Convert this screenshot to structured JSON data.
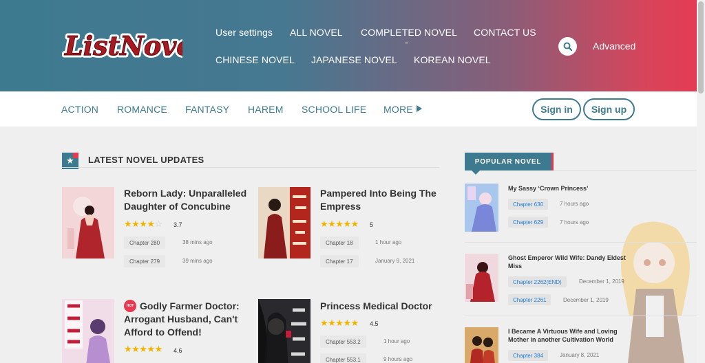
{
  "brand": {
    "logo_text": "ListNovel"
  },
  "nav": {
    "row1": [
      "User settings",
      "ALL NOVEL",
      "COMPLETED NOVEL",
      "CONTACT US"
    ],
    "row2": [
      "CHINESE NOVEL",
      "JAPANESE NOVEL",
      "KOREAN NOVEL"
    ],
    "advanced": "Advanced",
    "search_icon": "search-icon"
  },
  "genres": [
    "ACTION",
    "ROMANCE",
    "FANTASY",
    "HAREM",
    "SCHOOL LIFE",
    "MORE"
  ],
  "auth": {
    "sign_in": "Sign in",
    "sign_up": "Sign up"
  },
  "latest": {
    "heading": "LATEST NOVEL UPDATES",
    "novels": [
      {
        "title": "Reborn Lady: Unparalleled Daughter of Concubine",
        "rating": "3.7",
        "stars": 3.5,
        "chapters": [
          {
            "label": "Chapter 280",
            "time": "38 mins ago"
          },
          {
            "label": "Chapter 279",
            "time": "39 mins ago"
          }
        ]
      },
      {
        "title": "Pampered Into Being The Empress",
        "rating": "5",
        "stars": 5,
        "chapters": [
          {
            "label": "Chapter 18",
            "time": "1 hour ago"
          },
          {
            "label": "Chapter 17",
            "time": "January 9, 2021"
          }
        ]
      },
      {
        "title": "Godly Farmer Doctor: Arrogant Husband, Can't Afford to Offend!",
        "rating": "4.6",
        "stars": 4.5,
        "hot": "HOT",
        "chapters": []
      },
      {
        "title": "Princess Medical Doctor",
        "rating": "4.5",
        "stars": 4.5,
        "chapters": [
          {
            "label": "Chapter 553.2",
            "time": "1 hour ago"
          },
          {
            "label": "Chapter 553.1",
            "time": "9 hours ago"
          }
        ]
      }
    ]
  },
  "popular": {
    "heading": "POPULAR NOVEL",
    "novels": [
      {
        "title": "My Sassy ‘Crown Princess’",
        "chapters": [
          {
            "label": "Chapter 630",
            "time": "7 hours ago"
          },
          {
            "label": "Chapter 629",
            "time": "7 hours ago"
          }
        ]
      },
      {
        "title": "Ghost Emperor Wild Wife: Dandy Eldest Miss",
        "chapters": [
          {
            "label": "Chapter 2262(END)",
            "time": "December 1, 2019"
          },
          {
            "label": "Chapter 2261",
            "time": "December 1, 2019"
          }
        ]
      },
      {
        "title": "I Became A Virtuous Wife and Loving Mother in another Cultivation World",
        "chapters": [
          {
            "label": "Chapter 384",
            "time": "January 8, 2021"
          }
        ]
      }
    ]
  },
  "colors": {
    "primary": "#3d7a8f",
    "accent": "#e63a52",
    "star": "#f0b400",
    "link": "#1e7fd8"
  }
}
